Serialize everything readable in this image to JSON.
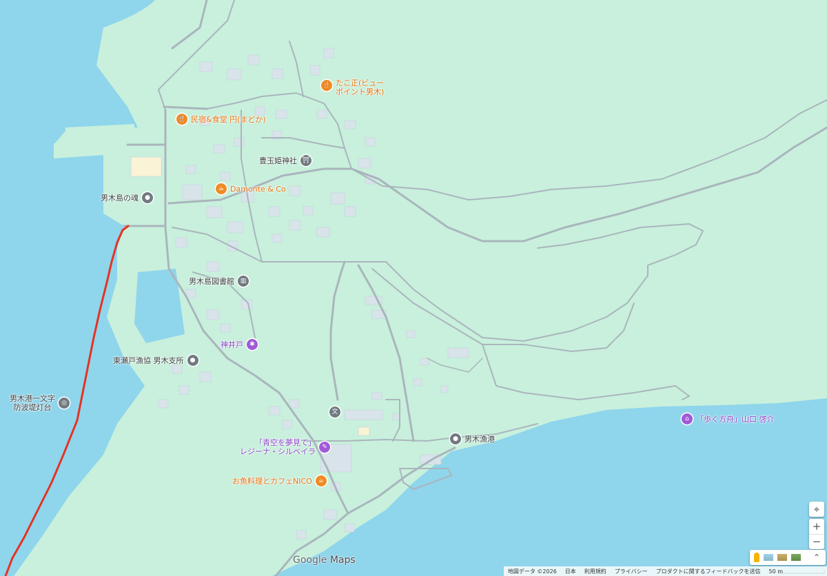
{
  "map": {
    "land_color": "#c8f0dc",
    "water_color": "#8fd5ec",
    "road_color": "#a8b6c0",
    "route_color": "#e53222"
  },
  "pois": [
    {
      "id": "tako",
      "label_lines": [
        "たこ正(ビュー",
        "ポイント男木)"
      ],
      "category": "restaurant",
      "color": "orange",
      "icon": "fork-knife-icon"
    },
    {
      "id": "madoka",
      "label_lines": [
        "民宿&食堂 円(まどか)"
      ],
      "category": "restaurant",
      "color": "orange",
      "icon": "fork-knife-icon"
    },
    {
      "id": "toyotama",
      "label_lines": [
        "豊玉姫神社"
      ],
      "category": "shrine",
      "color": "gray",
      "icon": "torii-icon"
    },
    {
      "id": "damonte",
      "label_lines": [
        "Damonte & Co"
      ],
      "category": "cafe",
      "color": "orange",
      "icon": "cup-icon"
    },
    {
      "id": "ogijima-tamashii",
      "label_lines": [
        "男木島の魂"
      ],
      "category": "place",
      "color": "gray",
      "icon": "pin-icon"
    },
    {
      "id": "library",
      "label_lines": [
        "男木島図書館"
      ],
      "category": "library",
      "color": "gray",
      "icon": "book-icon"
    },
    {
      "id": "kamido",
      "label_lines": [
        "神井戸"
      ],
      "category": "landmark",
      "color": "purple",
      "icon": "star-icon"
    },
    {
      "id": "gyokyo",
      "label_lines": [
        "東瀬戸漁協 男木支所"
      ],
      "category": "place",
      "color": "gray",
      "icon": "pin-icon"
    },
    {
      "id": "lighthouse",
      "label_lines": [
        "男木港一文字",
        "防波堤灯台"
      ],
      "category": "landmark",
      "color": "gray",
      "icon": "target-icon"
    },
    {
      "id": "school",
      "label_lines": [
        ""
      ],
      "category": "school",
      "color": "gray",
      "icon": "school-icon"
    },
    {
      "id": "ogi-port",
      "label_lines": [
        "男木漁港"
      ],
      "category": "place",
      "color": "gray",
      "icon": "pin-icon"
    },
    {
      "id": "aozora",
      "label_lines": [
        "「青空を夢見て」",
        "レジーナ・シルベイラ"
      ],
      "category": "art",
      "color": "purple",
      "icon": "art-icon"
    },
    {
      "id": "nico",
      "label_lines": [
        "お魚料理とカフェNICO"
      ],
      "category": "cafe",
      "color": "orange",
      "icon": "cup-icon"
    },
    {
      "id": "aruku",
      "label_lines": [
        "「歩く方舟」山口 啓介"
      ],
      "category": "museum",
      "color": "purple",
      "icon": "museum-icon"
    }
  ],
  "branding": {
    "google": "Google",
    "maps": "Maps"
  },
  "controls": {
    "locate": "⌖",
    "zoom_in": "+",
    "zoom_out": "−",
    "expand": "⌃"
  },
  "footer": {
    "map_data": "地図データ ©2026",
    "country": "日本",
    "terms": "利用規約",
    "privacy": "プライバシー",
    "feedback": "プロダクトに関するフィードバックを送信",
    "scale": "50 m"
  }
}
